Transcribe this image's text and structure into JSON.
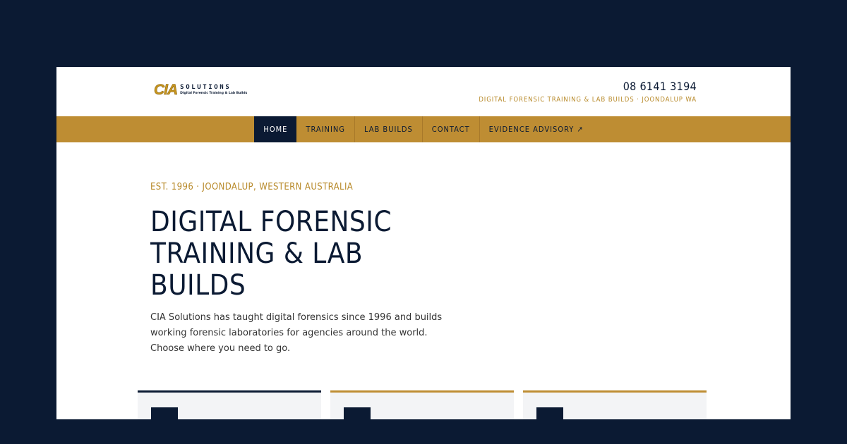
{
  "header": {
    "logo": {
      "mark": "CIA",
      "name": "SOLUTIONS",
      "tagline": "Digital Forensic Training & Lab Builds"
    },
    "phone": "08 6141 3194",
    "tagline": "DIGITAL FORENSIC TRAINING & LAB BUILDS · JOONDALUP WA"
  },
  "nav": {
    "items": [
      {
        "label": "HOME",
        "active": true
      },
      {
        "label": "TRAINING"
      },
      {
        "label": "LAB BUILDS"
      },
      {
        "label": "CONTACT"
      },
      {
        "label": "EVIDENCE ADVISORY",
        "icon": "external-link-icon",
        "glyph": "↗"
      }
    ]
  },
  "hero": {
    "eyebrow": "EST. 1996 · JOONDALUP, WESTERN AUSTRALIA",
    "title": "DIGITAL FORENSIC TRAINING & LAB BUILDS",
    "body": "CIA Solutions has taught digital forensics since 1996 and builds working forensic laboratories for agencies around the world. Choose where you need to go."
  },
  "cards": [
    {
      "icon": "close-icon",
      "glyph": "✕"
    },
    {
      "icon": "document-icon",
      "glyph": "▬"
    },
    {
      "icon": "box-icon",
      "glyph": "▭"
    }
  ],
  "colors": {
    "navy": "#0b1a33",
    "gold": "#be8d33",
    "gold_text": "#b88a2a",
    "card_bg": "#f3f4f6"
  }
}
